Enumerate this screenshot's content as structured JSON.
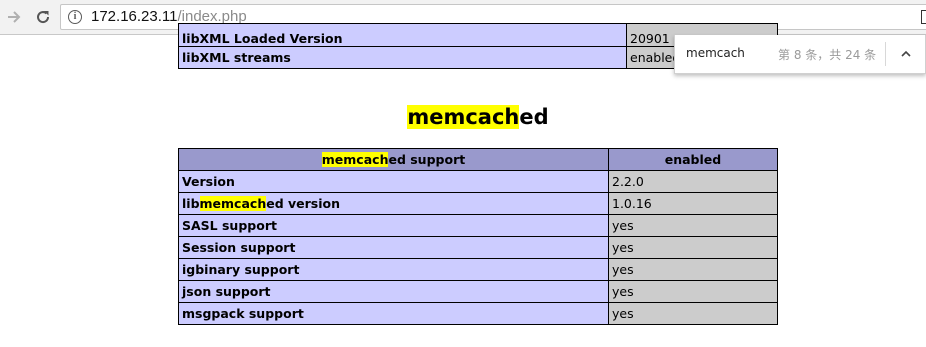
{
  "browser": {
    "url_host": "172.16.23.11",
    "url_path": "/index.php"
  },
  "top_table": {
    "rows": [
      {
        "label": "libXML Loaded Version",
        "value": "20901"
      },
      {
        "label": "libXML streams",
        "value": "enabled"
      }
    ]
  },
  "section": {
    "title_match": "memcach",
    "title_rest": "ed"
  },
  "memcached_table": {
    "header": {
      "col1_match": "memcach",
      "col1_rest": "ed support",
      "col2": "enabled"
    },
    "rows": [
      {
        "label": "Version",
        "value": "2.2.0"
      },
      {
        "label_pre": "lib",
        "label_match": "memcach",
        "label_rest": "ed version",
        "value": "1.0.16"
      },
      {
        "label": "SASL support",
        "value": "yes"
      },
      {
        "label": "Session support",
        "value": "yes"
      },
      {
        "label": "igbinary support",
        "value": "yes"
      },
      {
        "label": "json support",
        "value": "yes"
      },
      {
        "label": "msgpack support",
        "value": "yes"
      }
    ]
  },
  "find_bar": {
    "query": "memcach",
    "count": "第 8 条，共 24 条"
  },
  "colors": {
    "row_label_bg": "#ccccff",
    "row_value_bg": "#cccccc",
    "header_bg": "#9999cc",
    "highlight": "#ffff00"
  }
}
